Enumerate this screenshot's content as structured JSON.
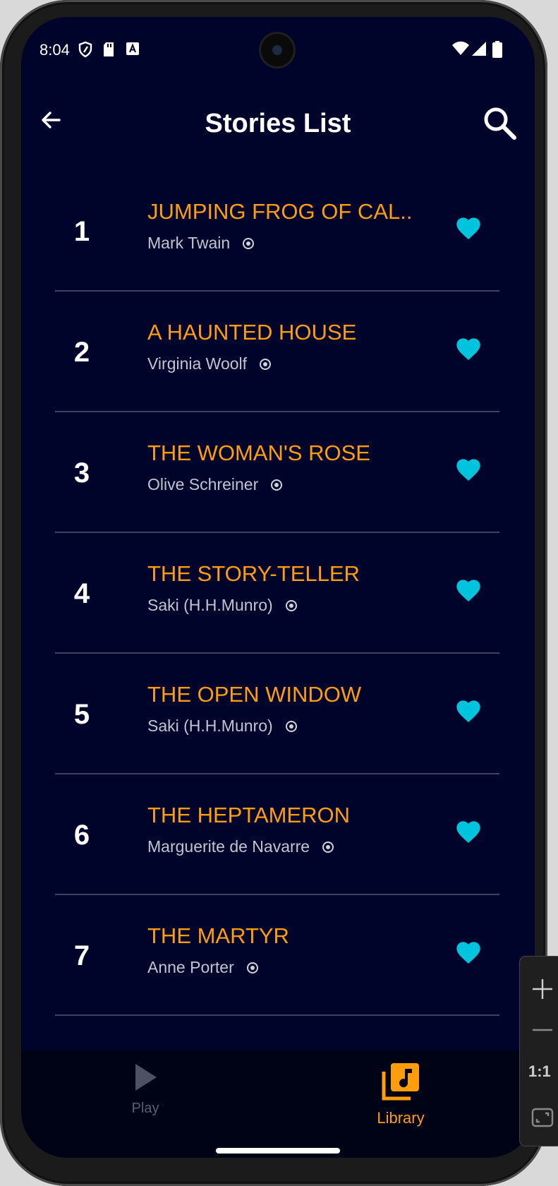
{
  "status_bar": {
    "time": "8:04",
    "left_icons": [
      "shield-icon",
      "sd-card-icon",
      "a-notification-icon"
    ],
    "right_icons": [
      "wifi-icon",
      "cell-signal-icon",
      "battery-icon"
    ]
  },
  "app_bar": {
    "title": "Stories List",
    "back_icon": "arrow-left-icon",
    "search_icon": "search-icon"
  },
  "stories": [
    {
      "number": "1",
      "title": "JUMPING FROG OF CAL..",
      "author": "Mark Twain",
      "favorite": true
    },
    {
      "number": "2",
      "title": "A HAUNTED HOUSE",
      "author": "Virginia Woolf",
      "favorite": true
    },
    {
      "number": "3",
      "title": "THE WOMAN'S ROSE",
      "author": "Olive Schreiner",
      "favorite": true
    },
    {
      "number": "4",
      "title": "THE STORY-TELLER",
      "author": "Saki (H.H.Munro)",
      "favorite": true
    },
    {
      "number": "5",
      "title": "THE OPEN WINDOW",
      "author": "Saki (H.H.Munro)",
      "favorite": true
    },
    {
      "number": "6",
      "title": "THE HEPTAMERON",
      "author": "Marguerite de Navarre",
      "favorite": true
    },
    {
      "number": "7",
      "title": "THE MARTYR",
      "author": "Anne Porter",
      "favorite": true
    }
  ],
  "bottom_nav": {
    "items": [
      {
        "label": "Play",
        "icon": "play-icon",
        "active": false
      },
      {
        "label": "Library",
        "icon": "library-music-icon",
        "active": true
      }
    ]
  },
  "zoom_panel": {
    "ratio_label": "1:1"
  },
  "colors": {
    "background": "#00042b",
    "title_accent": "#ff9d0a",
    "heart": "#00c4dd",
    "author": "#c2c4cf",
    "divider": "#3d425e",
    "nav_background": "#000215"
  }
}
